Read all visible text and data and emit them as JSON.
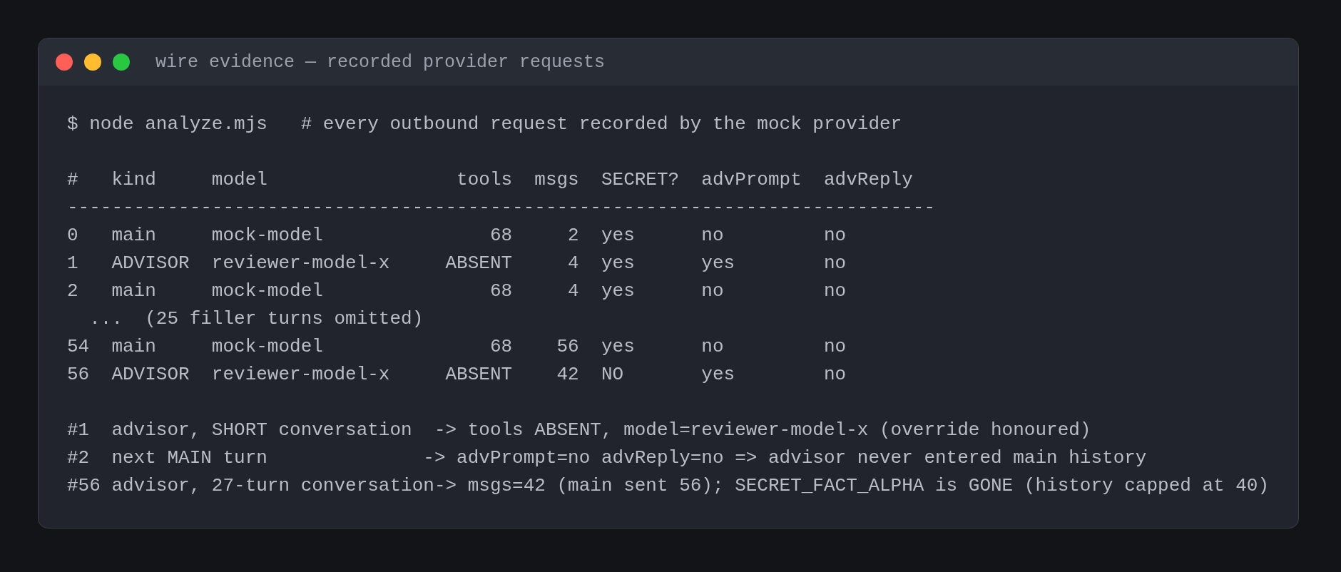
{
  "window": {
    "title": "wire evidence — recorded provider requests"
  },
  "lines": [
    {
      "kind": "command",
      "text": "$ node analyze.mjs   # every outbound request recorded by the mock provider"
    },
    {
      "kind": "blank"
    },
    {
      "kind": "header",
      "text": "#   kind     model                 tools  msgs  SECRET?  advPrompt  advReply"
    },
    {
      "kind": "divider",
      "text": "------------------------------------------------------------------------------"
    },
    {
      "kind": "row",
      "text": "0   main     mock-model               68     2  yes      no         no"
    },
    {
      "kind": "row",
      "text": "1   ADVISOR  reviewer-model-x     ABSENT     4  yes      yes        no"
    },
    {
      "kind": "row",
      "text": "2   main     mock-model               68     4  yes      no         no"
    },
    {
      "kind": "row",
      "text": "  ...  (25 filler turns omitted)"
    },
    {
      "kind": "row",
      "text": "54  main     mock-model               68    56  yes      no         no"
    },
    {
      "kind": "row",
      "text": "56  ADVISOR  reviewer-model-x     ABSENT    42  NO       yes        no"
    },
    {
      "kind": "blank"
    },
    {
      "kind": "note",
      "text": "#1  advisor, SHORT conversation  -> tools ABSENT, model=reviewer-model-x (override honoured)"
    },
    {
      "kind": "note",
      "text": "#2  next MAIN turn              -> advPrompt=no advReply=no => advisor never entered main history"
    },
    {
      "kind": "note",
      "text": "#56 advisor, 27-turn conversation-> msgs=42 (main sent 56); SECRET_FACT_ALPHA is GONE (history capped at 40)"
    }
  ]
}
